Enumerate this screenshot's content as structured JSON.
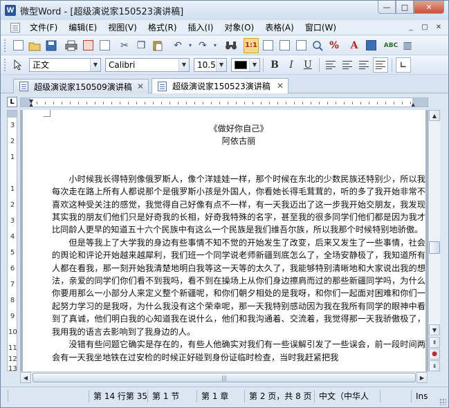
{
  "window": {
    "icon_letter": "W",
    "title": "微型Word - [超级演说家150523演讲稿]",
    "minimize": "—",
    "maximize": "□",
    "close": "✕"
  },
  "menu": {
    "items": [
      "文件(F)",
      "编辑(E)",
      "视图(V)",
      "格式(R)",
      "插入(I)",
      "对象(O)",
      "表格(A)",
      "窗口(W)"
    ],
    "mdi_minimize": "_",
    "mdi_restore": "□",
    "mdi_close": "✕"
  },
  "format": {
    "style": "正文",
    "font": "Calibri",
    "size": "10.5",
    "bold": "B",
    "italic": "I",
    "underline": "U"
  },
  "tabs": [
    {
      "label": "超级演说家150509演讲稿",
      "close": "✕"
    },
    {
      "label": "超级演说家150523演讲稿",
      "close": "✕"
    }
  ],
  "ruler": {
    "corner": "L",
    "vertical_numbers": [
      "3",
      "2",
      "1",
      "1",
      "2",
      "3",
      "4",
      "5",
      "6",
      "7",
      "8",
      "9",
      "10",
      "11",
      "12",
      "13"
    ]
  },
  "document": {
    "title": "《做好你自己》",
    "author": "阿依古丽",
    "paragraphs": [
      "小时候我长得特别像俄罗斯人，像个洋娃娃一样，那个时候在东北的少数民族还特别少，所以我每次走在路上所有人都说那个是俄罗斯小孩是外国人，你看她长得毛茸茸的，听的多了我开始非常不喜欢这种受关注的感觉，我觉得自己好像有点不一样，有一天我迈出了这一步我开始交朋友，我发现其实我的朋友们他们只是好奇我的长相，好奇我特殊的名字，甚至我的很多同学们他们都是因为我才比同龄人更早的知道五十六个民族中有这么一个民族是我们维吾尔族，所以我那个时候特别地骄傲。",
      "但是等我上了大学我的身边有些事情不知不觉的开始发生了改变，后来又发生了一些事情，社会的舆论和评论开始越来越犀利，我们班一个同学说老师新疆到底怎么了，全场安静极了，我知道所有人都在看我，那一刻开始我清楚地明白我等这一天等的太久了，我能够特别清晰地和大家说出我的想法，亲爱的同学们你们看不到我吗，看不到在操场上从你们身边擦肩而过的那些新疆同学吗，为什么你要用那么一小部分人来定义整个新疆呢，和你们朝夕相处的是我呀，和你们一起面对困难和你们一起努力学习的是我呀，为什么我没有这个荣幸呢，那一天我特别感动因为我在我所有同学的眼神中看到了真诚，他们明白我的心知道我在说什么，他们和我沟通着、交流着，我觉得那一天我骄傲极了，我用我的语言去影响到了我身边的人。",
      "没错有些问题它确实是存在的，有些人他确实对我们有一些误解引发了一些误会，前一段时间两会有一天我坐地铁在过安检的时候正好碰到身份证临时检查，当时我赶紧把我"
    ]
  },
  "scroll": {
    "up": "▲",
    "down": "▼",
    "prev_page": "⇞",
    "browse": "●",
    "next_page": "⇟",
    "left": "◀",
    "right": "▶",
    "thumb_grip": "|||"
  },
  "status": {
    "line": "第 14 行第 35",
    "section": "第 1 节",
    "chapter": "第 1 章",
    "page": "第 2 页，共 8 页",
    "language": "中文（中华人",
    "mode": "Ins"
  },
  "colors": {
    "accent": "#2a5699",
    "window_frame": "#dbe6f3",
    "doc_background": "#aab5c4"
  }
}
